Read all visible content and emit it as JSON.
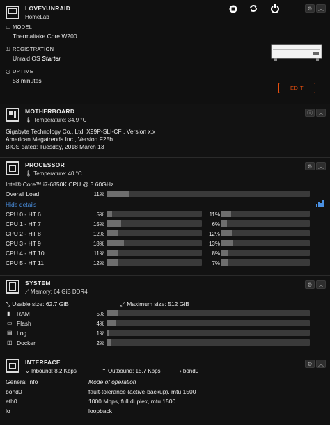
{
  "server": {
    "name": "LOVEYUNRAID",
    "description": "HomeLab",
    "model_label": "MODEL",
    "model": "Thermaltake Core W200",
    "registration_label": "REGISTRATION",
    "registration_prefix": "Unraid OS",
    "registration_edition": "Starter",
    "uptime_label": "UPTIME",
    "uptime": "53 minutes",
    "edit_label": "EDIT"
  },
  "motherboard": {
    "title": "MOTHERBOARD",
    "temperature": "Temperature: 34.9 °C",
    "line1": "Gigabyte Technology Co., Ltd. X99P-SLI-CF , Version x.x",
    "line2": "American Megatrends Inc., Version F25b",
    "line3": "BIOS dated: Tuesday, 2018 March 13"
  },
  "processor": {
    "title": "PROCESSOR",
    "temperature": "Temperature: 40 °C",
    "model": "Intel® Core™ i7-6850K CPU @ 3.60GHz",
    "overall_label": "Overall Load:",
    "overall_pct": "11%",
    "overall_value": 11,
    "hide_details": "Hide details",
    "cores": [
      {
        "left_label": "CPU 0 - HT 6",
        "left_pct": "5%",
        "left_value": 5,
        "right_pct": "11%",
        "right_value": 11
      },
      {
        "left_label": "CPU 1 - HT 7",
        "left_pct": "15%",
        "left_value": 15,
        "right_pct": "6%",
        "right_value": 6
      },
      {
        "left_label": "CPU 2 - HT 8",
        "left_pct": "12%",
        "left_value": 12,
        "right_pct": "12%",
        "right_value": 12
      },
      {
        "left_label": "CPU 3 - HT 9",
        "left_pct": "18%",
        "left_value": 18,
        "right_pct": "13%",
        "right_value": 13
      },
      {
        "left_label": "CPU 4 - HT 10",
        "left_pct": "11%",
        "left_value": 11,
        "right_pct": "8%",
        "right_value": 8
      },
      {
        "left_label": "CPU 5 - HT 11",
        "left_pct": "12%",
        "left_value": 12,
        "right_pct": "7%",
        "right_value": 7
      }
    ]
  },
  "system": {
    "title": "SYSTEM",
    "memory": "Memory: 64 GiB DDR4",
    "usable": "Usable size: 62.7 GiB",
    "maximum": "Maximum size: 512 GiB",
    "items": [
      {
        "label": "RAM",
        "pct": "5%",
        "value": 5
      },
      {
        "label": "Flash",
        "pct": "4%",
        "value": 4
      },
      {
        "label": "Log",
        "pct": "1%",
        "value": 1
      },
      {
        "label": "Docker",
        "pct": "2%",
        "value": 2
      }
    ]
  },
  "interface": {
    "title": "INTERFACE",
    "inbound": "Inbound: 8.2 Kbps",
    "outbound": "Outbound: 15.7 Kbps",
    "selected": "bond0",
    "col1_header": "General info",
    "col2_header": "Mode of operation",
    "rows": [
      {
        "name": "bond0",
        "info": "fault-tolerance (active-backup), mtu 1500"
      },
      {
        "name": "eth0",
        "info": "1000 Mbps, full duplex, mtu 1500"
      },
      {
        "name": "lo",
        "info": "loopback"
      }
    ]
  }
}
